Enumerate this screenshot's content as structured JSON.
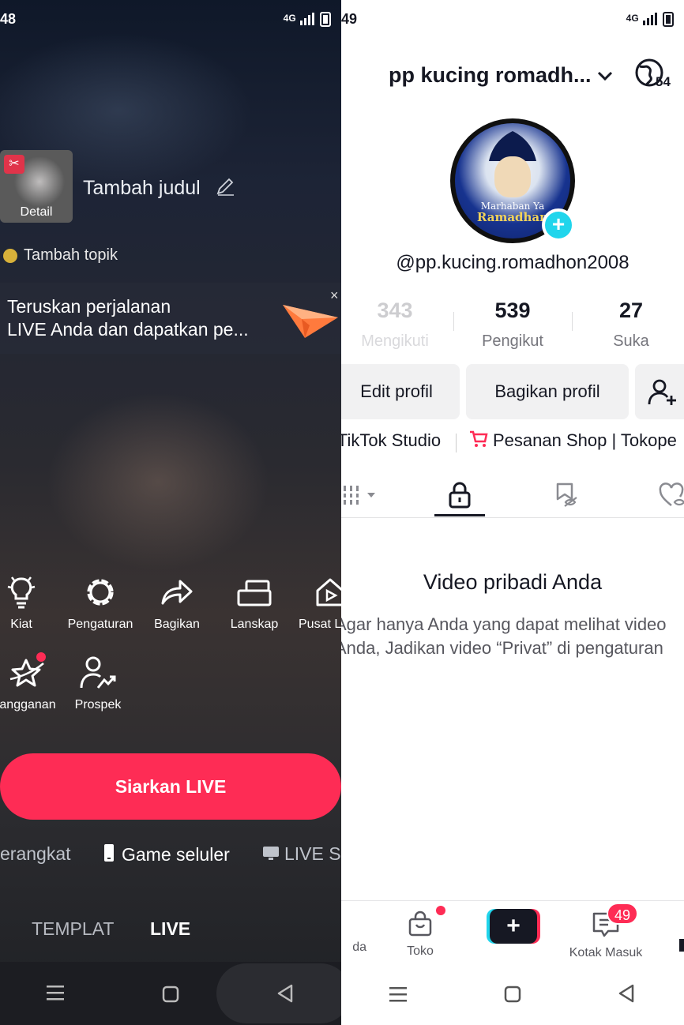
{
  "left": {
    "status": {
      "time": "48",
      "signal": "4G"
    },
    "thumbnail": {
      "label": "Detail"
    },
    "title_placeholder": "Tambah judul",
    "topic": "Tambah topik",
    "promo": {
      "line1": "Teruskan perjalanan",
      "line2": "LIVE Anda dan dapatkan pe...",
      "close": "×"
    },
    "tools": [
      {
        "label": "Kiat",
        "icon": "lightbulb-icon"
      },
      {
        "label": "Pengaturan",
        "icon": "gear-icon"
      },
      {
        "label": "Bagikan",
        "icon": "share-icon"
      },
      {
        "label": "Lanskap",
        "icon": "landscape-icon"
      },
      {
        "label": "Pusat L",
        "icon": "home-play-icon"
      },
      {
        "label": "angganan",
        "icon": "star-icon"
      },
      {
        "label": "Prospek",
        "icon": "user-growth-icon"
      }
    ],
    "go_live_label": "Siarkan LIVE",
    "modes": {
      "m1": "erangkat",
      "m2": "Game seluler",
      "m3": "LIVE S"
    },
    "tabs": {
      "t1": "TEMPLAT",
      "t2": "LIVE"
    }
  },
  "right": {
    "status": {
      "time": "49",
      "signal": "4G"
    },
    "profile_name": "pp kucing romadh...",
    "notif_count": "54",
    "avatar": {
      "line1": "Marhaban Ya",
      "line2": "Ramadhan"
    },
    "handle": "@pp.kucing.romadhon2008",
    "stats": [
      {
        "num": "343",
        "label": "Mengikuti"
      },
      {
        "num": "539",
        "label": "Pengikut"
      },
      {
        "num": "27",
        "label": "Suka"
      }
    ],
    "buttons": {
      "edit": "Edit profil",
      "share": "Bagikan profil"
    },
    "links": {
      "studio": "iTikTok Studio",
      "shop": "Pesanan Shop | Tokope"
    },
    "empty": {
      "title": "Video pribadi Anda",
      "line1": "Agar hanya Anda yang dapat melihat video",
      "line2": "Anda, Jadikan video “Privat” di pengaturan"
    },
    "bottom_nav": {
      "home": "da",
      "shop": "Toko",
      "inbox": "Kotak Masuk",
      "inbox_badge": "49"
    }
  },
  "colors": {
    "brand_red": "#fe2c55",
    "brand_cyan": "#20d5ec",
    "text_dark": "#161823"
  }
}
